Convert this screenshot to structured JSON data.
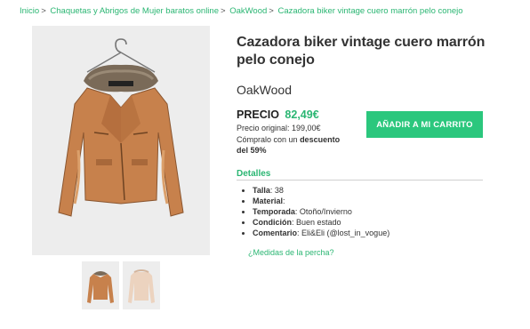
{
  "breadcrumb": {
    "items": [
      "Inicio",
      "Chaquetas y Abrigos de Mujer baratos online",
      "OakWood",
      "Cazadora biker vintage cuero marrón pelo conejo"
    ],
    "separator": ">"
  },
  "product": {
    "title": "Cazadora biker vintage cuero marrón pelo conejo",
    "brand": "OakWood",
    "price_label": "PRECIO",
    "price": "82,49€",
    "original_price": "Precio original: 199,00€",
    "discount_prefix": "Cómpralo con un",
    "discount_bold": "descuento del 59%",
    "add_to_cart": "AÑADIR A MI CARRITO"
  },
  "details": {
    "heading": "Detalles",
    "items": [
      {
        "label": "Talla",
        "value": ": 38"
      },
      {
        "label": "Material",
        "value": ":"
      },
      {
        "label": "Temporada",
        "value": ": Otoño/Invierno"
      },
      {
        "label": "Condición",
        "value": ": Buen estado"
      },
      {
        "label": "Comentario",
        "value": ": Eli&Eli (@lost_in_vogue)"
      }
    ],
    "measure_link": "¿Medidas de la percha?"
  },
  "colors": {
    "accent": "#2bb673",
    "button": "#2bc77d",
    "jacket": "#c7814c",
    "thumb_jacket_2": "#ecd3bf"
  }
}
